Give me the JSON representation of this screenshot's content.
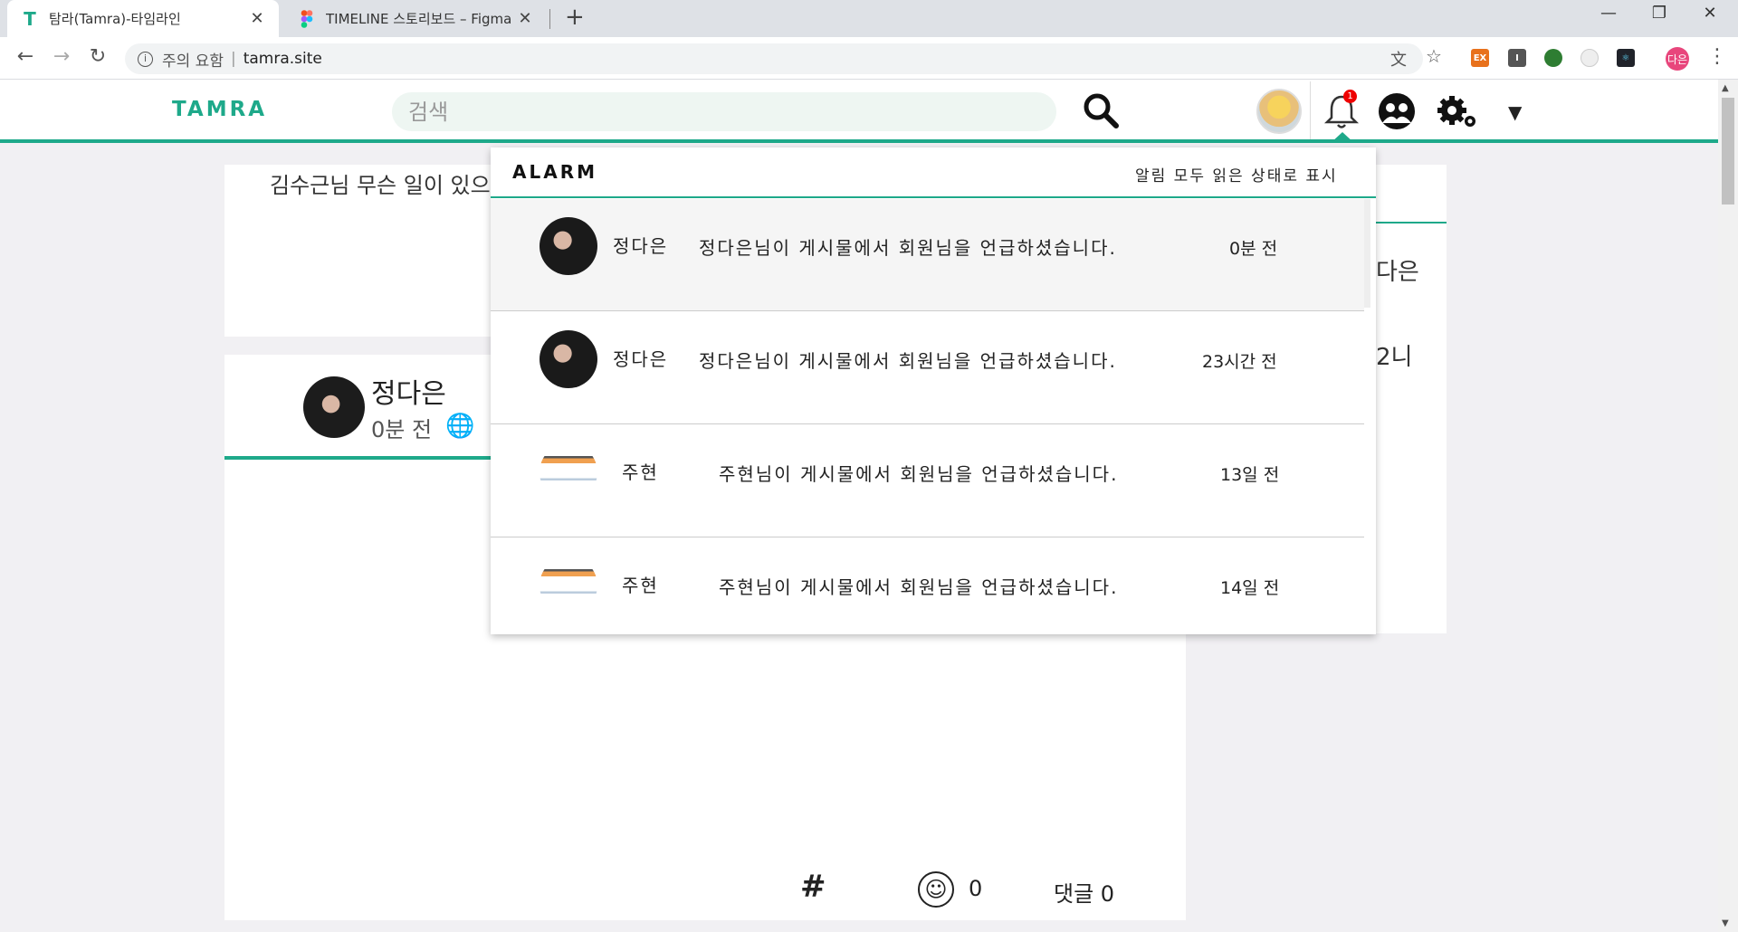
{
  "browser": {
    "tabs": [
      {
        "title": "탐라(Tamra)-타임라인",
        "favicon": "T"
      },
      {
        "title": "TIMELINE 스토리보드 – Figma",
        "favicon": "figma-icon"
      }
    ],
    "address": {
      "security_label": "주의 요함",
      "separator": "|",
      "url": "tamra.site"
    },
    "extensions": [
      {
        "name": "ex-extension",
        "label": "EX",
        "color": "#e8711c"
      },
      {
        "name": "i-extension",
        "label": "I",
        "color": "#555555"
      },
      {
        "name": "green-extension",
        "label": "",
        "color": "#2e7d32"
      },
      {
        "name": "circle-extension",
        "label": "",
        "color": "#cccccc"
      },
      {
        "name": "react-devtools-extension",
        "label": "",
        "color": "#20232a"
      }
    ],
    "profile": "다은"
  },
  "app": {
    "logo": "TAMRA",
    "search_placeholder": "검색",
    "notification_count": "1"
  },
  "feed": {
    "top_text": "김수근님 무슨 일이 있으",
    "post": {
      "author": "정다은",
      "time": "0분 전"
    },
    "right_texts": [
      "다은",
      "2니"
    ],
    "footer": {
      "hash": "#",
      "likes": "0",
      "comments": "댓글 0"
    }
  },
  "alarm": {
    "title": "ALARM",
    "mark_all_read": "알림 모두 읽은 상태로 표시",
    "items": [
      {
        "name": "정다은",
        "message": "정다은님이 게시물에서 회원님을 언급하셨습니다.",
        "time": "0분 전",
        "avatar": "photo"
      },
      {
        "name": "정다은",
        "message": "정다은님이 게시물에서 회원님을 언급하셨습니다.",
        "time": "23시간 전",
        "avatar": "photo"
      },
      {
        "name": "주현",
        "message": "주현님이 게시물에서 회원님을 언급하셨습니다.",
        "time": "13일 전",
        "avatar": "screenshot"
      },
      {
        "name": "주현",
        "message": "주현님이 게시물에서 회원님을 언급하셨습니다.",
        "time": "14일 전",
        "avatar": "screenshot"
      }
    ]
  },
  "colors": {
    "accent": "#1ea98a",
    "badge": "#ee0000"
  }
}
